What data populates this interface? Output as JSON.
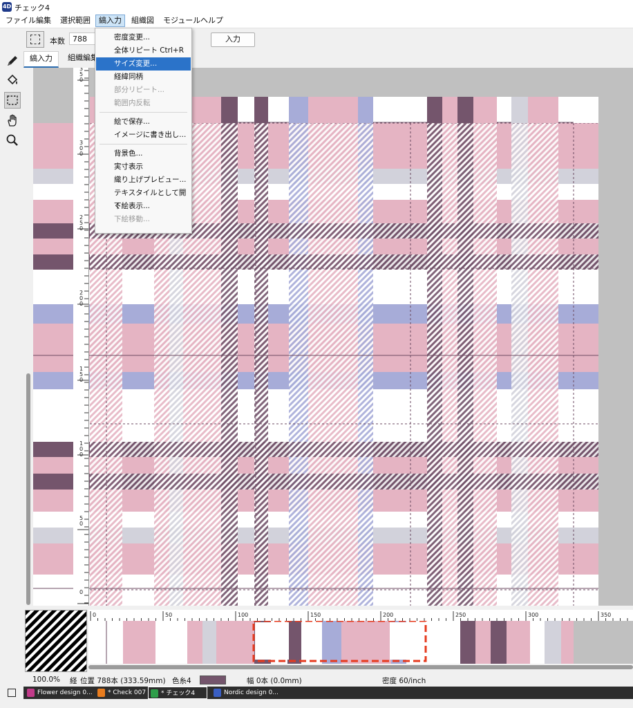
{
  "window": {
    "title": "チェック4",
    "app_icon": "4D"
  },
  "menubar": {
    "items": [
      "ファイル",
      "編集",
      "選択範囲",
      "縞入力",
      "組織図",
      "モジュール",
      "ヘルプ"
    ],
    "active_index": 3
  },
  "toolbar": {
    "count_label": "本数",
    "count_value": "788",
    "input_button": "入力"
  },
  "tabs": [
    "縞入力",
    "組織編集"
  ],
  "tools": [
    "pencil-icon",
    "paint-bucket-icon",
    "rect-select-icon",
    "hand-icon",
    "zoom-icon"
  ],
  "dropdown": {
    "items": [
      {
        "label": "密度変更...",
        "shortcut": "",
        "state": "normal"
      },
      {
        "label": "全体リピート",
        "shortcut": "Ctrl+R",
        "state": "normal"
      },
      {
        "label": "サイズ変更...",
        "shortcut": "",
        "state": "highlighted"
      },
      {
        "label": "経緯同柄",
        "shortcut": "",
        "state": "normal"
      },
      {
        "label": "部分リピート...",
        "shortcut": "",
        "state": "disabled"
      },
      {
        "label": "範囲内反転",
        "shortcut": "",
        "state": "disabled"
      },
      {
        "label": "---"
      },
      {
        "label": "絵で保存...",
        "shortcut": "",
        "state": "normal"
      },
      {
        "label": "イメージに書き出し...",
        "shortcut": "",
        "state": "normal"
      },
      {
        "label": "---"
      },
      {
        "label": "背景色...",
        "shortcut": "",
        "state": "normal"
      },
      {
        "label": "実寸表示",
        "shortcut": "",
        "state": "normal"
      },
      {
        "label": "織り上げプレビュー...",
        "shortcut": "",
        "state": "normal"
      },
      {
        "label": "テキスタイルとして開く",
        "shortcut": "",
        "state": "normal"
      },
      {
        "label": "下絵表示...",
        "shortcut": "",
        "state": "normal"
      },
      {
        "label": "下絵移動...",
        "shortcut": "",
        "state": "disabled"
      }
    ]
  },
  "vruler_labels": [
    "350",
    "300",
    "250",
    "200",
    "150",
    "100",
    "50",
    "0"
  ],
  "hruler_labels": [
    "0",
    "50",
    "100",
    "150",
    "200",
    "250",
    "300",
    "350"
  ],
  "colors": {
    "pink": "#e5b4c3",
    "plum": "#74556c",
    "lavender": "#a7acd8",
    "grey": "#d2d2db",
    "white": "#ffffff",
    "selection": "#e63a1e",
    "accent": "#2b73c9"
  },
  "status": {
    "zoom": "100.0%",
    "direction": "経",
    "position": "位置 788本 (333.59mm)",
    "color_thread": "色糸4",
    "width": "幅 0本 (0.0mm)",
    "density": "密度 60/inch"
  },
  "taskbar": [
    {
      "label": "Flower design 0...",
      "color": "#c23b8a",
      "active": false
    },
    {
      "label": "* Check 007",
      "color": "#e87c1e",
      "active": false
    },
    {
      "label": "* チェック4",
      "color": "#2f9e4a",
      "active": true
    },
    {
      "label": "Nordic design 0...",
      "color": "#3a5fc4",
      "active": false
    }
  ]
}
